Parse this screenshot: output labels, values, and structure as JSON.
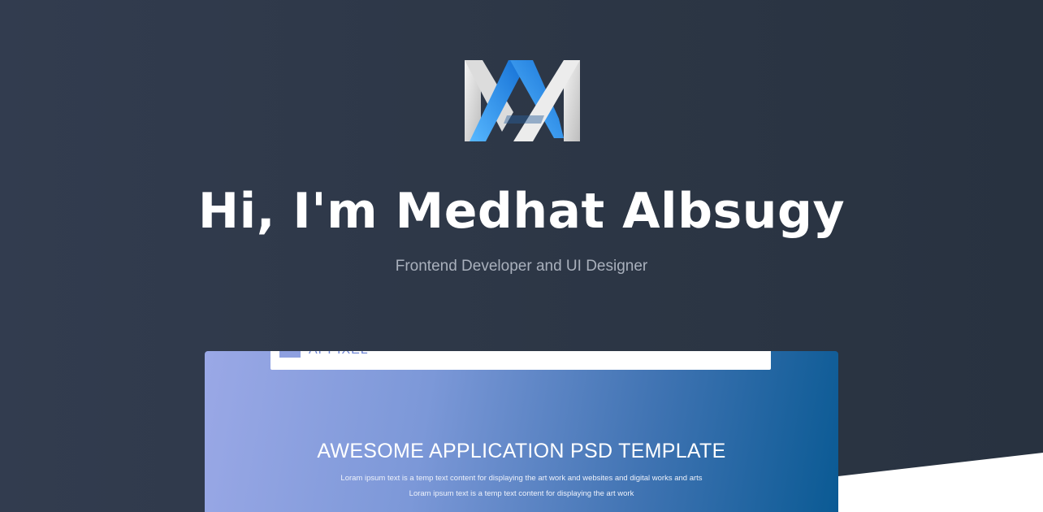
{
  "hero": {
    "logo_icon": "ma-monogram-logo-icon",
    "title": "Hi, I'm Medhat Albsugy",
    "subtitle": "Frontend Developer and UI Designer"
  },
  "preview": {
    "brand": "APPIXEL",
    "heading": "AWESOME APPLICATION PSD TEMPLATE",
    "line1": "Loram ipsum text is a temp text content for displaying the art work and websites and digital works and arts",
    "line2": "Loram ipsum text is a temp text content for displaying the art work"
  },
  "colors": {
    "background": "#2e3848",
    "logo_blue": "#1f8ff0",
    "preview_gradient_start": "#9aa8e6",
    "preview_gradient_end": "#0a5a94"
  }
}
